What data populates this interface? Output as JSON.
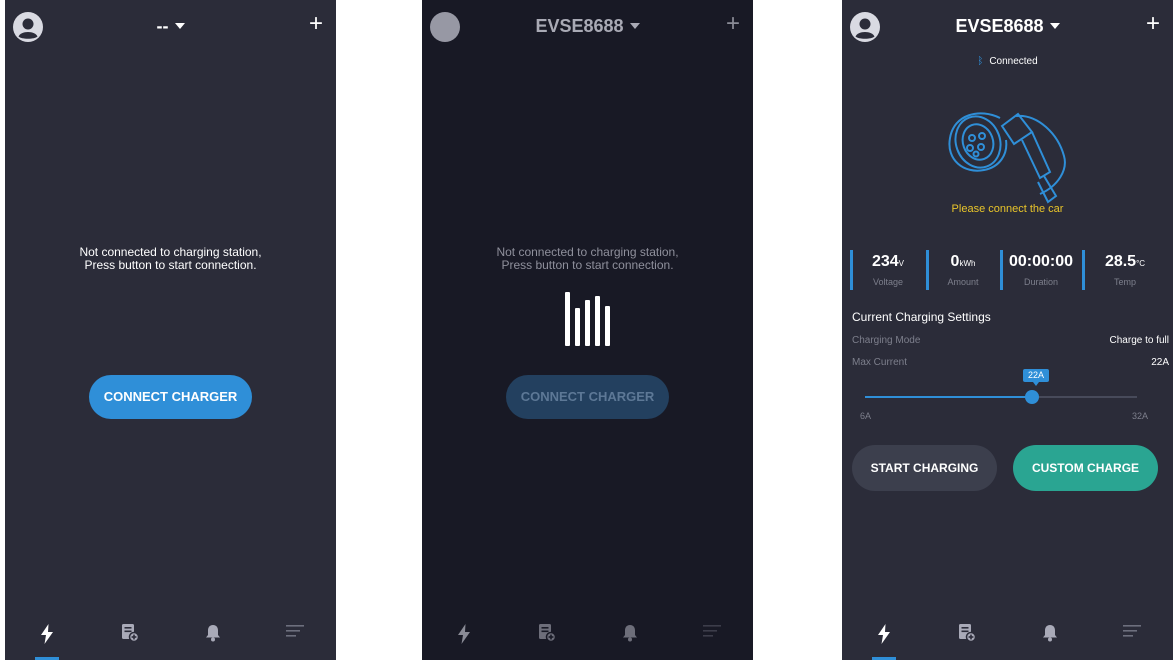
{
  "colors": {
    "accent": "#2f8fd8",
    "teal": "#2aa592",
    "warning": "#e9c52a",
    "bg": "#2b2c39",
    "bg_loading": "#181925"
  },
  "screens": [
    {
      "device_name": "--",
      "message_line1": "Not connected to charging station,",
      "message_line2": "Press button to start connection.",
      "connect_label": "CONNECT CHARGER",
      "tabs": [
        {
          "icon": "lightning-icon",
          "active": true
        },
        {
          "icon": "record-list-icon",
          "active": false
        },
        {
          "icon": "bell-icon",
          "active": false
        },
        {
          "icon": "menu-icon",
          "active": false
        }
      ]
    },
    {
      "device_name": "EVSE8688",
      "message_line1": "Not connected to charging station,",
      "message_line2": "Press button to start connection.",
      "connect_label": "CONNECT CHARGER",
      "loading_icon": "loading-bars-icon"
    },
    {
      "device_name": "EVSE8688",
      "status": "Connected",
      "status_icon": "bluetooth-icon",
      "prompt": "Please connect the car",
      "stats": [
        {
          "value": "234",
          "unit": "V",
          "label": "Voltage"
        },
        {
          "value": "0",
          "unit": "kWh",
          "label": "Amount"
        },
        {
          "value": "00:00:00",
          "unit": "",
          "label": "Duration"
        },
        {
          "value": "28.5",
          "unit": "°C",
          "label": "Temp"
        }
      ],
      "settings_title": "Current Charging Settings",
      "charging_mode_label": "Charging Mode",
      "charging_mode_value": "Charge to full",
      "max_current_label": "Max Current",
      "max_current_value": "22A",
      "slider": {
        "min_label": "6A",
        "max_label": "32A",
        "min": 6,
        "max": 32,
        "value": 22,
        "tooltip": "22A"
      },
      "start_label": "START CHARGING",
      "custom_label": "CUSTOM CHARGE"
    }
  ]
}
